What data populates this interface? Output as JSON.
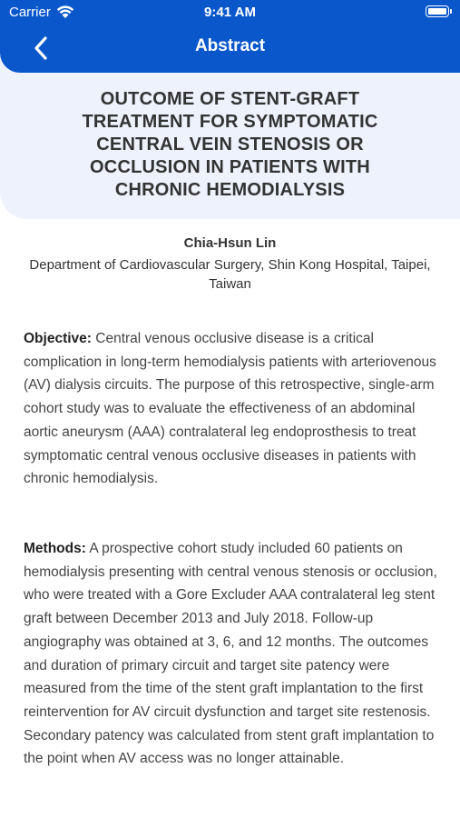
{
  "status_bar": {
    "carrier": "Carrier",
    "time": "9:41 AM"
  },
  "nav": {
    "title": "Abstract",
    "back_icon": "chevron-left-icon"
  },
  "article": {
    "title": "OUTCOME OF STENT-GRAFT TREATMENT FOR SYMPTOMATIC CENTRAL VEIN STENOSIS OR OCCLUSION IN PATIENTS WITH CHRONIC HEMODIALYSIS",
    "author": "Chia-Hsun Lin",
    "affiliation": "Department of Cardiovascular Surgery, Shin Kong Hospital, Taipei, Taiwan"
  },
  "sections": [
    {
      "label": "Objective:",
      "text": " Central venous occlusive disease is a critical complication in long-term hemodialysis patients with arteriovenous (AV) dialysis circuits. The purpose of this retrospective, single-arm cohort study was to evaluate the effectiveness of an abdominal aortic aneurysm (AAA) contralateral leg endoprosthesis to treat symptomatic central venous occlusive diseases in patients with chronic hemodialysis."
    },
    {
      "label": "Methods:",
      "text": " A prospective cohort study included 60 patients on hemodialysis presenting with central venous stenosis or occlusion, who were treated with a Gore Excluder AAA contralateral leg stent graft between December 2013 and July 2018. Follow-up angiography was obtained at 3, 6, and 12 months. The outcomes and duration of primary circuit and target site patency were measured from the time of the stent graft implantation to the first reintervention for AV circuit dysfunction and target site restenosis. Secondary patency was calculated from stent graft implantation to the point when AV access was no longer attainable."
    }
  ],
  "colors": {
    "nav_background": "#0a57cc",
    "title_card_background": "#eef2fd"
  }
}
